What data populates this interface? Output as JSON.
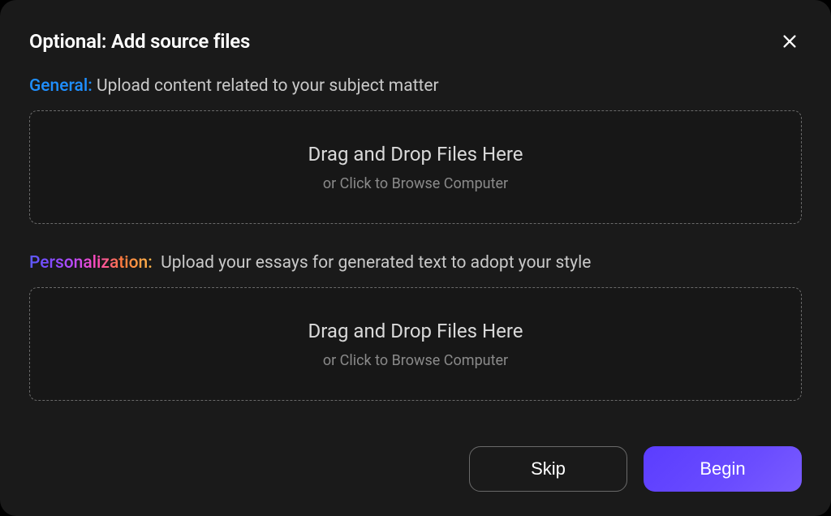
{
  "title": "Optional: Add source files",
  "sections": {
    "general": {
      "label": "General:",
      "description": "Upload content related to your subject matter",
      "dropzone_title": "Drag and Drop Files Here",
      "dropzone_sub": "or Click to Browse Computer"
    },
    "personalization": {
      "label": "Personalization:",
      "description": "Upload your essays for generated text to adopt your style",
      "dropzone_title": "Drag and Drop Files Here",
      "dropzone_sub": "or Click to Browse Computer"
    }
  },
  "footer": {
    "skip_label": "Skip",
    "begin_label": "Begin"
  }
}
